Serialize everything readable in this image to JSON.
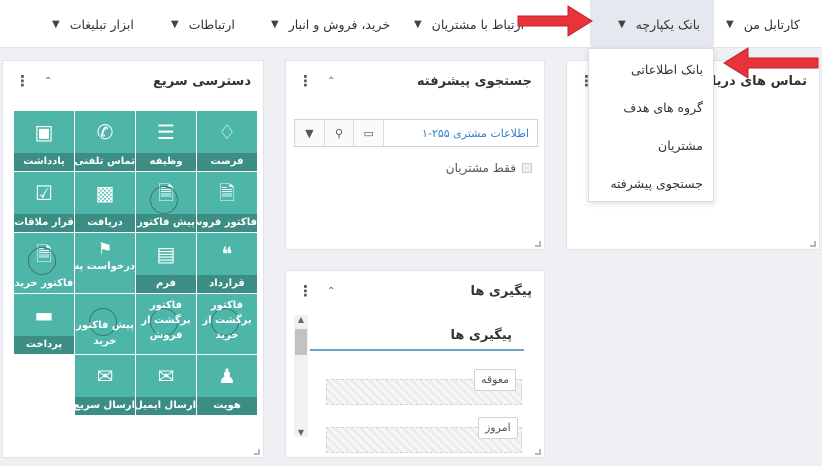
{
  "menu": {
    "items": [
      {
        "label": "کارتابل من"
      },
      {
        "label": "بانک یکپارچه"
      },
      {
        "label": "ارتباط با مشتریان"
      },
      {
        "label": "خرید، فروش و انبار"
      },
      {
        "label": "ارتباطات"
      },
      {
        "label": "ابزار تبلیغات"
      }
    ],
    "active_index": 1
  },
  "dropdown": {
    "items": [
      {
        "label": "بانک اطلاعاتی"
      },
      {
        "label": "گروه های هدف"
      },
      {
        "label": "مشتریان"
      },
      {
        "label": "جستجوی پیشرفته"
      }
    ]
  },
  "widgets": {
    "quick_access": {
      "title": "دسترسی سریع",
      "tiles": [
        {
          "label": "فرصت",
          "icon": "diamond-icon"
        },
        {
          "label": "وظیفه",
          "icon": "server-icon"
        },
        {
          "label": "تماس تلفنی",
          "icon": "phone-icon"
        },
        {
          "label": "یادداشت",
          "icon": "note-icon"
        },
        {
          "label": "فاکتور فروش",
          "icon": "document-icon"
        },
        {
          "label": "پیش فاکتور",
          "icon": "quote-document-icon"
        },
        {
          "label": "دریافت",
          "icon": "cash-icon"
        },
        {
          "label": "قرار ملاقات",
          "icon": "calendar-check-icon"
        },
        {
          "label": "قرارداد",
          "icon": "quotes-icon"
        },
        {
          "label": "فرم",
          "icon": "newspaper-icon"
        },
        {
          "label": "درخواست پشتیبانی",
          "icon": "tag-icon"
        },
        {
          "label": "فاکتور خرید",
          "icon": "purchase-invoice-icon"
        },
        {
          "label": "فاکتور برگشت از خرید",
          "icon": "return-purchase-icon"
        },
        {
          "label": "فاکتور برگشت از فروش",
          "icon": "return-sale-icon"
        },
        {
          "label": "پیش فاکتور خرید",
          "icon": "purchase-quote-icon"
        },
        {
          "label": "پرداخت",
          "icon": "credit-card-icon"
        },
        {
          "label": "هویت",
          "icon": "user-icon"
        },
        {
          "label": "ارسال ایمیل",
          "icon": "envelope-icon"
        },
        {
          "label": "ارسال سریع",
          "icon": "envelope-fill-icon"
        }
      ]
    },
    "advanced_search": {
      "title": "جستجوی پیشرفته",
      "search_value": "اطلاعات مشتری ۲۵۵-۱",
      "checkbox_label": "فقط مشتریان"
    },
    "received_calls": {
      "title": "تماس های دریافتی"
    },
    "followups": {
      "title": "پیگیری ها",
      "inner_title": "پیگیری ها",
      "tags": [
        {
          "label": "معوقه"
        },
        {
          "label": "امروز"
        }
      ]
    }
  },
  "colors": {
    "tile": "#4db6a8",
    "tile_label_bg": "#3c8e85",
    "arrow": "#e8333a"
  }
}
